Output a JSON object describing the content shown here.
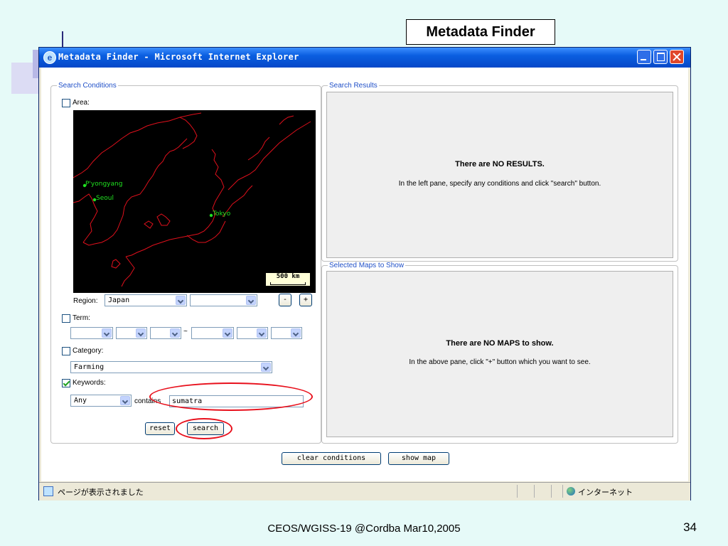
{
  "slide": {
    "title": "Metadata Finder",
    "footer": "CEOS/WGISS-19 @Cordba Mar10,2005",
    "page_number": "34"
  },
  "window": {
    "title": "Metadata Finder - Microsoft Internet Explorer",
    "title_icon": "ie-icon",
    "titlebar_color": "#0a5ee0"
  },
  "search_conditions": {
    "legend": "Search Conditions",
    "area_label": "Area:",
    "area_checked": false,
    "map": {
      "places": [
        "P'yongyang",
        "Seoul",
        "Tokyo"
      ],
      "scale_label": "500 km"
    },
    "region_label": "Region:",
    "region_value": "Japan",
    "region_sub_value": "",
    "zoom_out": "-",
    "zoom_in": "+",
    "term_label": "Term:",
    "term_checked": false,
    "term_sep": "~",
    "category_label": "Category:",
    "category_checked": false,
    "category_value": "Farming",
    "keywords_label": "Keywords:",
    "keywords_checked": true,
    "keywords_mode": "Any",
    "contains_label": "contains",
    "keywords_value": "sumatra",
    "reset_label": "reset",
    "search_label": "search"
  },
  "search_results": {
    "legend": "Search Results",
    "message": "There are NO RESULTS.",
    "hint": "In the left pane, specify any conditions and click \"search\" button."
  },
  "selected_maps": {
    "legend": "Selected Maps to Show",
    "message": "There are NO MAPS to show.",
    "hint": "In the above pane, click \"+\" button which you want to see."
  },
  "bottom_buttons": {
    "clear": "clear conditions",
    "show_map": "show map"
  },
  "statusbar": {
    "text": "ページが表示されました",
    "zone": "インターネット"
  },
  "colors": {
    "slide_bg": "#e6faf8",
    "highlight": "#e8101c",
    "coastline": "#e0101c",
    "city": "#20e020"
  }
}
